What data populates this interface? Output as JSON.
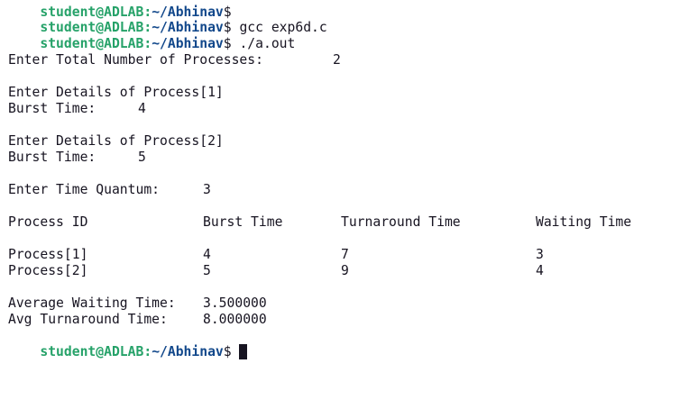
{
  "colors": {
    "background": "#ffffff",
    "text": "#171421",
    "prompt_user": "#26a269",
    "prompt_path": "#12488b"
  },
  "prompt": {
    "user_host": "student@ADLAB",
    "colon": ":",
    "path": "~/Abhinav",
    "dollar": "$"
  },
  "commands": [
    " gcc exp6d.c",
    " ./a.out"
  ],
  "output": {
    "total_label": "Enter Total Number of Processes:",
    "total_value": "2",
    "process1_header": "Enter Details of Process[1]",
    "process1_burst_label": "Burst Time:",
    "process1_burst_value": "4",
    "process2_header": "Enter Details of Process[2]",
    "process2_burst_label": "Burst Time:",
    "process2_burst_value": "5",
    "quantum_label": "Enter Time Quantum:",
    "quantum_value": "3",
    "table": {
      "headers": [
        "Process ID",
        "Burst Time",
        "Turnaround Time",
        "Waiting Time"
      ],
      "rows": [
        [
          "Process[1]",
          "4",
          "7",
          "3"
        ],
        [
          "Process[2]",
          "5",
          "9",
          "4"
        ]
      ]
    },
    "avg_waiting_label": "Average Waiting Time:",
    "avg_waiting_value": "3.500000",
    "avg_turnaround_label": "Avg Turnaround Time:",
    "avg_turnaround_value": "8.000000"
  }
}
